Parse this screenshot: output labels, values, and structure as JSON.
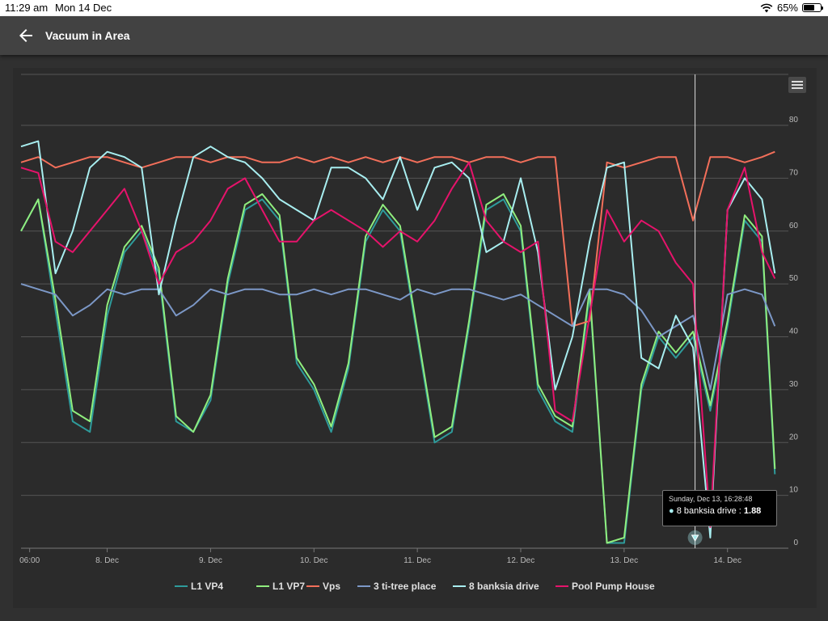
{
  "status_bar": {
    "time": "11:29 am",
    "date": "Mon 14 Dec",
    "battery": "65%",
    "battery_level": 0.65
  },
  "header": {
    "title": "Vacuum in Area"
  },
  "icons": {
    "back": "arrow-left-icon",
    "menu": "hamburger-icon",
    "wifi": "wifi-icon",
    "battery": "battery-icon"
  },
  "tooltip": {
    "date": "Sunday, Dec 13, 16:28:48",
    "series": "8 banksia drive",
    "separator": " : ",
    "value": "1.88"
  },
  "chart_data": {
    "type": "line",
    "title": "",
    "xlabel": "",
    "ylabel": "",
    "x_range": [
      "2020-12-07 04:00",
      "2020-12-14 11:30"
    ],
    "ylim": [
      0,
      80
    ],
    "y_ticks": [
      "0",
      "10",
      "20",
      "30",
      "40",
      "50",
      "60",
      "70",
      "80"
    ],
    "x_ticks": [
      {
        "at": "2020-12-07 06:00",
        "label": "06:00"
      },
      {
        "at": "2020-12-08 00:00",
        "label": "8. Dec"
      },
      {
        "at": "2020-12-09 00:00",
        "label": "9. Dec"
      },
      {
        "at": "2020-12-10 00:00",
        "label": "10. Dec"
      },
      {
        "at": "2020-12-11 00:00",
        "label": "11. Dec"
      },
      {
        "at": "2020-12-12 00:00",
        "label": "12. Dec"
      },
      {
        "at": "2020-12-13 00:00",
        "label": "13. Dec"
      },
      {
        "at": "2020-12-14 00:00",
        "label": "14. Dec"
      }
    ],
    "grid": true,
    "legend_position": "bottom-center",
    "crosshair_x": "2020-12-13 16:28",
    "x": [
      "2020-12-07 04:00",
      "2020-12-07 08:00",
      "2020-12-07 12:00",
      "2020-12-07 16:00",
      "2020-12-07 20:00",
      "2020-12-08 00:00",
      "2020-12-08 04:00",
      "2020-12-08 08:00",
      "2020-12-08 12:00",
      "2020-12-08 16:00",
      "2020-12-08 20:00",
      "2020-12-09 00:00",
      "2020-12-09 04:00",
      "2020-12-09 08:00",
      "2020-12-09 12:00",
      "2020-12-09 16:00",
      "2020-12-09 20:00",
      "2020-12-10 00:00",
      "2020-12-10 04:00",
      "2020-12-10 08:00",
      "2020-12-10 12:00",
      "2020-12-10 16:00",
      "2020-12-10 20:00",
      "2020-12-11 00:00",
      "2020-12-11 04:00",
      "2020-12-11 08:00",
      "2020-12-11 12:00",
      "2020-12-11 16:00",
      "2020-12-11 20:00",
      "2020-12-12 00:00",
      "2020-12-12 04:00",
      "2020-12-12 08:00",
      "2020-12-12 12:00",
      "2020-12-12 16:00",
      "2020-12-12 20:00",
      "2020-12-13 00:00",
      "2020-12-13 04:00",
      "2020-12-13 08:00",
      "2020-12-13 12:00",
      "2020-12-13 16:00",
      "2020-12-13 20:00",
      "2020-12-14 00:00",
      "2020-12-14 04:00",
      "2020-12-14 08:00",
      "2020-12-14 11:00"
    ],
    "series": [
      {
        "name": "L1 VP4",
        "color": "#2e9b9b",
        "values": [
          60,
          66,
          45,
          24,
          22,
          44,
          56,
          60,
          52,
          24,
          22,
          28,
          50,
          64,
          66,
          62,
          35,
          30,
          22,
          34,
          58,
          64,
          60,
          40,
          20,
          22,
          42,
          64,
          66,
          60,
          30,
          24,
          22,
          48,
          1,
          1,
          30,
          40,
          36,
          40,
          26,
          42,
          62,
          58,
          14
        ]
      },
      {
        "name": "L1 VP7",
        "color": "#90ee7e",
        "values": [
          60,
          66,
          47,
          26,
          24,
          46,
          57,
          61,
          53,
          25,
          22,
          29,
          51,
          65,
          67,
          63,
          36,
          31,
          23,
          35,
          59,
          65,
          61,
          41,
          21,
          23,
          43,
          65,
          67,
          61,
          31,
          25,
          23,
          49,
          1,
          2,
          31,
          41,
          37,
          41,
          27,
          43,
          63,
          59,
          15
        ]
      },
      {
        "name": "Vps",
        "color": "#f36f5a",
        "values": [
          73,
          74,
          72,
          73,
          74,
          74,
          73,
          72,
          73,
          74,
          74,
          73,
          74,
          74,
          73,
          73,
          74,
          73,
          74,
          73,
          74,
          73,
          74,
          73,
          74,
          74,
          73,
          74,
          74,
          73,
          74,
          74,
          42,
          43,
          73,
          72,
          73,
          74,
          74,
          62,
          74,
          74,
          73,
          74,
          75
        ]
      },
      {
        "name": "3 ti-tree place",
        "color": "#7c98c7",
        "values": [
          50,
          49,
          48,
          44,
          46,
          49,
          48,
          49,
          49,
          44,
          46,
          49,
          48,
          49,
          49,
          48,
          48,
          49,
          48,
          49,
          49,
          48,
          47,
          49,
          48,
          49,
          49,
          48,
          47,
          48,
          46,
          44,
          42,
          49,
          49,
          48,
          45,
          40,
          42,
          44,
          30,
          48,
          49,
          48,
          42
        ]
      },
      {
        "name": "8 banksia drive",
        "color": "#a8eef0",
        "values": [
          76,
          77,
          52,
          60,
          72,
          75,
          74,
          72,
          48,
          62,
          74,
          76,
          74,
          73,
          70,
          66,
          64,
          62,
          72,
          72,
          70,
          66,
          74,
          64,
          72,
          73,
          70,
          56,
          58,
          70,
          56,
          30,
          40,
          58,
          72,
          73,
          36,
          34,
          44,
          38,
          2,
          64,
          70,
          66,
          52
        ]
      },
      {
        "name": "Pool Pump House",
        "color": "#e6136b",
        "values": [
          72,
          71,
          58,
          56,
          60,
          64,
          68,
          60,
          50,
          56,
          58,
          62,
          68,
          70,
          64,
          58,
          58,
          62,
          64,
          62,
          60,
          57,
          60,
          58,
          62,
          68,
          73,
          62,
          58,
          56,
          58,
          26,
          24,
          44,
          64,
          58,
          62,
          60,
          54,
          50,
          4,
          64,
          72,
          56,
          51
        ]
      }
    ]
  }
}
